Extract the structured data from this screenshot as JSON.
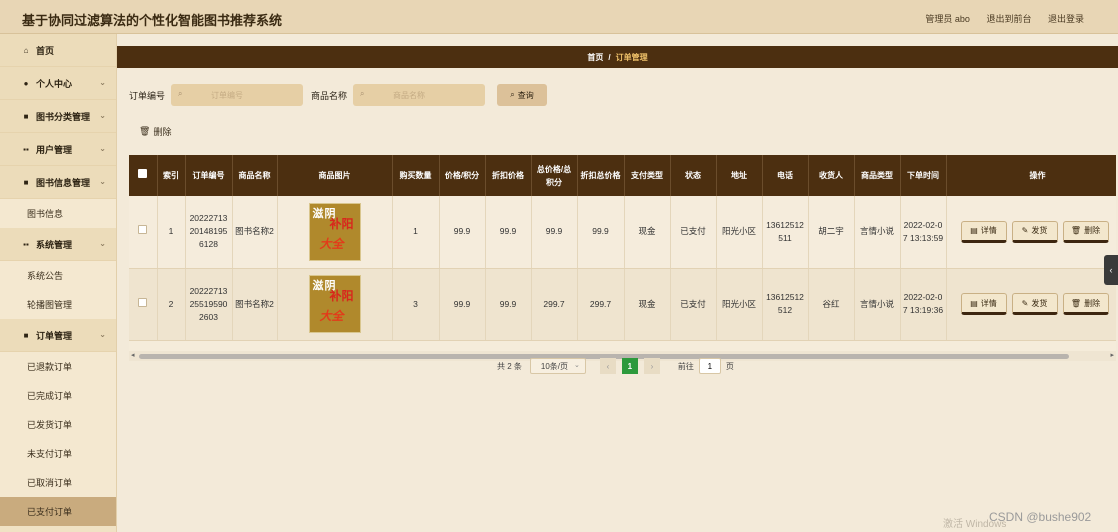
{
  "app": {
    "title": "基于协同过滤算法的个性化智能图书推荐系统",
    "admin_label": "管理员 abo",
    "link_front": "退出到前台",
    "link_logout": "退出登录"
  },
  "sidebar": {
    "items": [
      {
        "label": "首页",
        "icon": "home-icon"
      },
      {
        "label": "个人中心",
        "icon": "user-icon"
      },
      {
        "label": "图书分类管理",
        "icon": "book-icon"
      },
      {
        "label": "用户管理",
        "icon": "grid-icon"
      },
      {
        "label": "图书信息管理",
        "icon": "book-icon"
      },
      {
        "label": "图书信息"
      },
      {
        "label": "系统管理",
        "icon": "grid-icon"
      },
      {
        "label": "系统公告"
      },
      {
        "label": "轮播图管理"
      },
      {
        "label": "订单管理",
        "icon": "book-icon"
      },
      {
        "label": "已退款订单"
      },
      {
        "label": "已完成订单"
      },
      {
        "label": "已发货订单"
      },
      {
        "label": "未支付订单"
      },
      {
        "label": "已取消订单"
      },
      {
        "label": "已支付订单"
      }
    ]
  },
  "breadcrumb": {
    "home": "首页",
    "sep": "/",
    "current": "订单管理"
  },
  "search": {
    "order_no_label": "订单编号",
    "order_no_placeholder": "订单编号",
    "product_label": "商品名称",
    "product_placeholder": "商品名称",
    "query_label": "查询"
  },
  "toolbar": {
    "delete_label": "删除"
  },
  "table": {
    "headers": [
      "索引",
      "订单编号",
      "商品名称",
      "商品图片",
      "购买数量",
      "价格/积分",
      "折扣价格",
      "总价格/总积分",
      "折扣总价格",
      "支付类型",
      "状态",
      "地址",
      "电话",
      "收货人",
      "商品类型",
      "下单时间",
      "操作"
    ],
    "rows": [
      {
        "index": "1",
        "order_no": "2022271320148195 6128",
        "product": "图书名称2",
        "image_text": [
          "滋阴",
          "补阳",
          "大全"
        ],
        "qty": "1",
        "price": "99.9",
        "discount_price": "99.9",
        "total": "99.9",
        "discount_total": "99.9",
        "pay_type": "现金",
        "status": "已支付",
        "address": "阳光小区",
        "phone": "13612512511",
        "receiver": "胡二宇",
        "category": "言情小说",
        "order_time": "2022-02-07 13:13:59"
      },
      {
        "index": "2",
        "order_no": "2022271325519590 2603",
        "product": "图书名称2",
        "image_text": [
          "滋阴",
          "补阳",
          "大全"
        ],
        "qty": "3",
        "price": "99.9",
        "discount_price": "99.9",
        "total": "299.7",
        "discount_total": "299.7",
        "pay_type": "现金",
        "status": "已支付",
        "address": "阳光小区",
        "phone": "13612512512",
        "receiver": "谷红",
        "category": "言情小说",
        "order_time": "2022-02-07 13:19:36"
      }
    ],
    "row_actions": {
      "detail": "详情",
      "ship": "发货",
      "delete": "删除"
    }
  },
  "pagination": {
    "total": "共 2 条",
    "page_size": "10条/页",
    "prev": "‹",
    "current": "1",
    "next": "›",
    "goto_label": "前往",
    "goto_value": "1",
    "goto_suffix": "页"
  },
  "side_tab": "‹",
  "watermark": {
    "activate": "激活 Windows",
    "csdn": "CSDN @bushe902"
  },
  "colors": {
    "header_brown": "#4c2f10",
    "accent_gold": "#f1c36a",
    "page_green": "#2c9a3c"
  }
}
